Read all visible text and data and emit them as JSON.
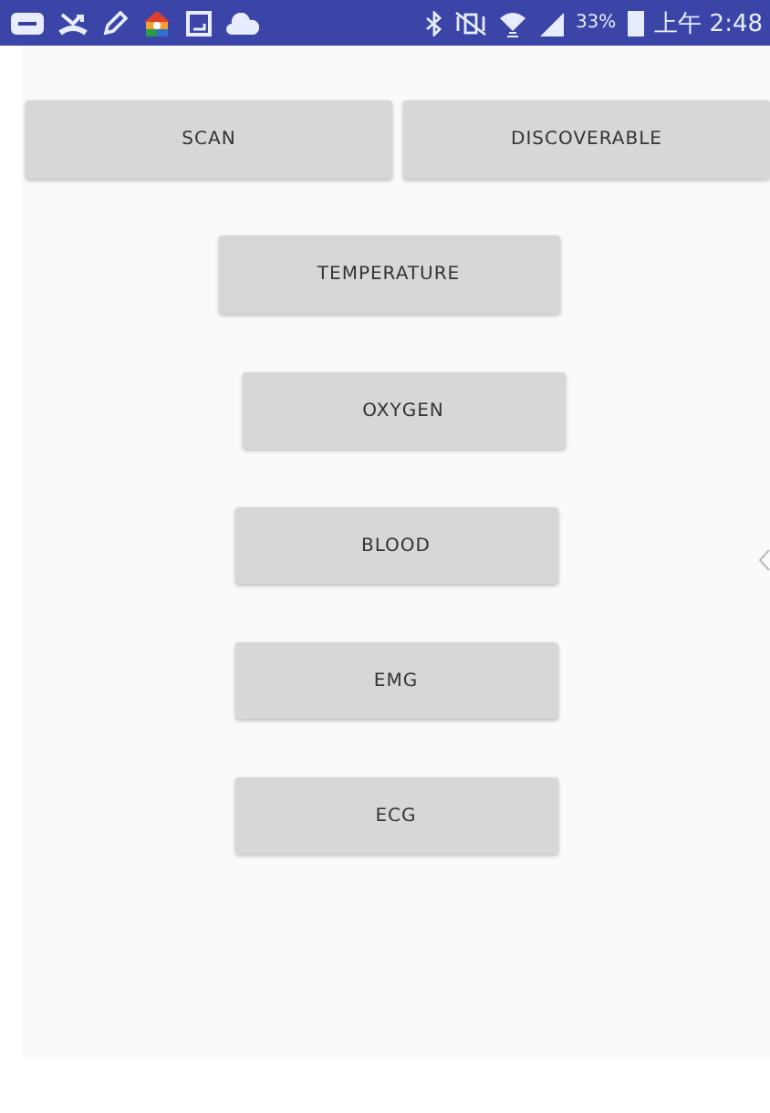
{
  "status_bar": {
    "battery_percent": "33%",
    "time": "上午 2:48"
  },
  "top_buttons": [
    {
      "label": "SCAN"
    },
    {
      "label": "DISCOVERABLE"
    }
  ],
  "buttons": [
    {
      "label": "TEMPERATURE",
      "kind": "wide"
    },
    {
      "label": "OXYGEN",
      "kind": "normal"
    },
    {
      "label": "BLOOD",
      "kind": "normal"
    },
    {
      "label": "EMG",
      "kind": "normal"
    },
    {
      "label": "ECG",
      "kind": "normal"
    }
  ]
}
